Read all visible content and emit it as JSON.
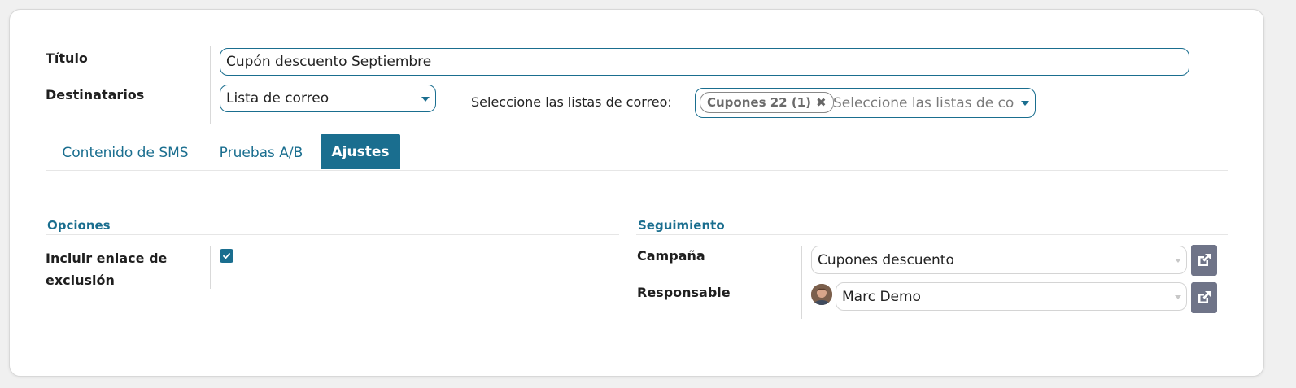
{
  "form": {
    "title_label": "Título",
    "title_value": "Cupón descuento Septiembre",
    "recipients_label": "Destinatarios",
    "recipients_value": "Lista de correo",
    "mailing_lists_label": "Seleccione las listas de correo:",
    "mailing_list_tag": "Cupones 22 (1)",
    "mailing_lists_placeholder": "Seleccione las listas de correo"
  },
  "tabs": [
    {
      "label": "Contenido de SMS",
      "active": false
    },
    {
      "label": "Pruebas A/B",
      "active": false
    },
    {
      "label": "Ajustes",
      "active": true
    }
  ],
  "options": {
    "section_title": "Opciones",
    "optout_label_line1": "Incluir enlace de",
    "optout_label_line2": "exclusión",
    "optout_checked": true
  },
  "tracking": {
    "section_title": "Seguimiento",
    "campaign_label": "Campaña",
    "campaign_value": "Cupones descuento",
    "responsible_label": "Responsable",
    "responsible_value": "Marc Demo"
  },
  "colors": {
    "accent": "#1a6e8f",
    "external_button": "#6f7488"
  },
  "icons": {
    "tag_remove": "x-icon",
    "external_link": "external-link-icon",
    "checkbox": "check-icon"
  }
}
